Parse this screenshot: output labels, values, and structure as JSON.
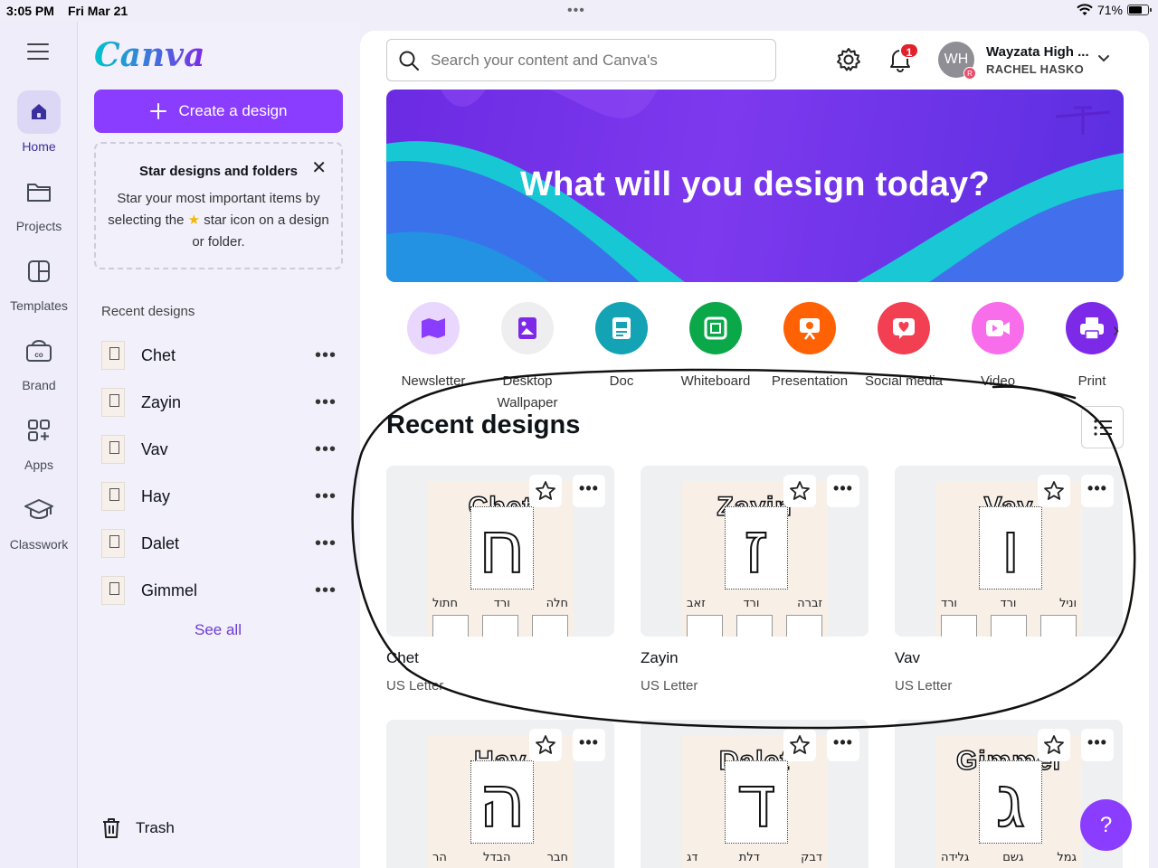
{
  "status": {
    "time": "3:05 PM",
    "date": "Fri Mar 21",
    "battery": "71%"
  },
  "rail": {
    "items": [
      {
        "label": "Home"
      },
      {
        "label": "Projects"
      },
      {
        "label": "Templates"
      },
      {
        "label": "Brand"
      },
      {
        "label": "Apps"
      },
      {
        "label": "Classwork"
      }
    ]
  },
  "panel": {
    "logo": "Canva",
    "create_label": "Create a design",
    "star_card": {
      "title": "Star designs and folders",
      "body_before": "Star your most important items by selecting the",
      "body_after": "star icon on a design or folder."
    },
    "recent_heading": "Recent designs",
    "recent": [
      {
        "name": "Chet"
      },
      {
        "name": "Zayin"
      },
      {
        "name": "Vav"
      },
      {
        "name": "Hay"
      },
      {
        "name": "Dalet"
      },
      {
        "name": "Gimmel"
      }
    ],
    "see_all": "See all",
    "trash": "Trash"
  },
  "header": {
    "search_placeholder": "Search your content and Canva's",
    "notifications": "1",
    "avatar_initials": "WH",
    "avatar_mini": "R",
    "org": "Wayzata High ...",
    "user": "RACHEL HASKO"
  },
  "hero": {
    "title": "What will you design today?"
  },
  "categories": [
    {
      "label": "Newsletter",
      "color": "#e9d7fd"
    },
    {
      "label": "Desktop Wallpaper",
      "color": "#eeeef0"
    },
    {
      "label": "Doc",
      "color": "#13a3b5"
    },
    {
      "label": "Whiteboard",
      "color": "#0ba84a"
    },
    {
      "label": "Presentation",
      "color": "#ff6105"
    },
    {
      "label": "Social media",
      "color": "#f23f51"
    },
    {
      "label": "Video",
      "color": "#f86dea"
    },
    {
      "label": "Print",
      "color": "#7d2ae8"
    }
  ],
  "recent_section": {
    "title": "Recent designs"
  },
  "designs": [
    {
      "title": "Chet",
      "type": "US Letter",
      "word": "Chet",
      "letter": "ח",
      "words": [
        "חתול",
        "ורד",
        "חלה"
      ]
    },
    {
      "title": "Zayin",
      "type": "US Letter",
      "word": "Zayin",
      "letter": "ז",
      "words": [
        "זאב",
        "ורד",
        "זברה"
      ]
    },
    {
      "title": "Vav",
      "type": "US Letter",
      "word": "Vav",
      "letter": "ו",
      "words": [
        "ורד",
        "ורד",
        "וניל"
      ]
    },
    {
      "title": "",
      "type": "",
      "word": "Hay",
      "letter": "ה",
      "words": [
        "הר",
        "הבדל",
        "חבר"
      ]
    },
    {
      "title": "",
      "type": "",
      "word": "Dalet",
      "letter": "ד",
      "words": [
        "דג",
        "דלת",
        "דבק"
      ]
    },
    {
      "title": "",
      "type": "",
      "word": "Gimmel",
      "letter": "ג",
      "words": [
        "גלידה",
        "גשם",
        "גמל"
      ]
    }
  ],
  "help_label": "?"
}
